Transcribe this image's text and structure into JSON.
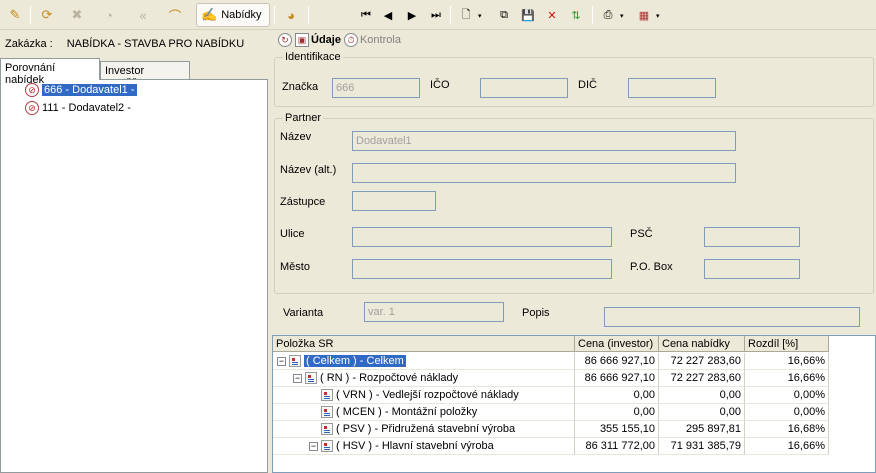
{
  "toolbar": {
    "nabidky_label": "Nabídky"
  },
  "left": {
    "zakazka_label": "Zakázka :",
    "zakazka_value": "NABÍDKA - STAVBA PRO NABÍDKU",
    "tabs": [
      {
        "label": "Porovnání nabídek"
      },
      {
        "label": "Investor soutěže"
      }
    ],
    "tree": [
      {
        "label": "666 - Dodavatel1 -",
        "selected": true
      },
      {
        "label": "111 - Dodavatel2 -",
        "selected": false
      }
    ]
  },
  "right": {
    "tabs": [
      {
        "label": "Údaje"
      },
      {
        "label": "Kontrola"
      }
    ],
    "identifikace": {
      "title": "Identifikace",
      "znacka_label": "Značka",
      "znacka_value": "666",
      "ico_label": "IČO",
      "ico_value": "",
      "dic_label": "DIČ",
      "dic_value": ""
    },
    "partner": {
      "title": "Partner",
      "nazev_label": "Název",
      "nazev_value": "Dodavatel1",
      "nazev_alt_label": "Název (alt.)",
      "nazev_alt_value": "",
      "zastupce_label": "Zástupce",
      "zastupce_value": "",
      "ulice_label": "Ulice",
      "ulice_value": "",
      "psc_label": "PSČ",
      "psc_value": "",
      "mesto_label": "Město",
      "mesto_value": "",
      "pobox_label": "P.O. Box",
      "pobox_value": ""
    },
    "varianta_label": "Varianta",
    "varianta_value": "var. 1",
    "popis_label": "Popis",
    "popis_value": ""
  },
  "grid": {
    "headers": [
      "Položka SR",
      "Cena (investor)",
      "Cena nabídky",
      "Rozdíl [%]"
    ],
    "rows": [
      {
        "label": "( Celkem ) - Celkem",
        "investor": "86 666 927,10",
        "nabidka": "72 227 283,60",
        "rozdil": "16,66%",
        "level": 0,
        "expander": "−",
        "selected": true
      },
      {
        "label": "( RN ) - Rozpočtové náklady",
        "investor": "86 666 927,10",
        "nabidka": "72 227 283,60",
        "rozdil": "16,66%",
        "level": 1,
        "expander": "−",
        "selected": false
      },
      {
        "label": "( VRN ) - Vedlejší rozpočtové náklady",
        "investor": "0,00",
        "nabidka": "0,00",
        "rozdil": "0,00%",
        "level": 2,
        "expander": "",
        "selected": false
      },
      {
        "label": "( MCEN ) - Montážní položky",
        "investor": "0,00",
        "nabidka": "0,00",
        "rozdil": "0,00%",
        "level": 2,
        "expander": "",
        "selected": false
      },
      {
        "label": "( PSV ) - Přidružená stavební výroba",
        "investor": "355 155,10",
        "nabidka": "295 897,81",
        "rozdil": "16,68%",
        "level": 2,
        "expander": "",
        "selected": false
      },
      {
        "label": "( HSV ) - Hlavní stavební výroba",
        "investor": "86 311 772,00",
        "nabidka": "71 931 385,79",
        "rozdil": "16,66%",
        "level": 2,
        "expander": "−",
        "selected": false
      }
    ]
  }
}
